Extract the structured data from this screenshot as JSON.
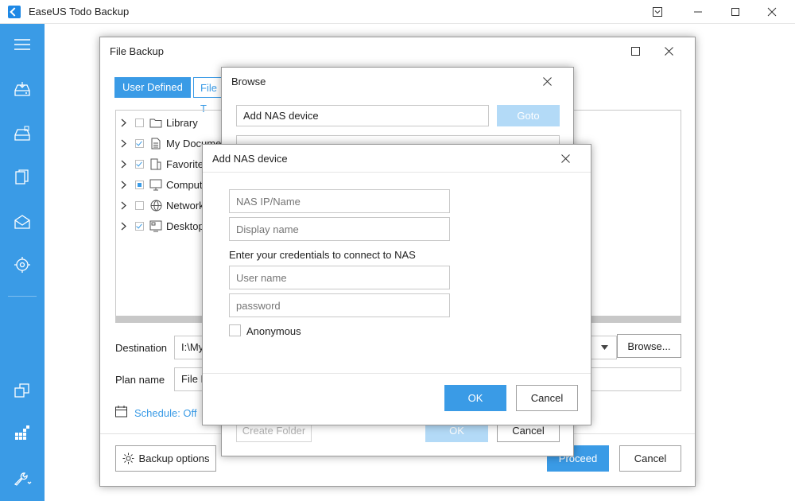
{
  "app": {
    "title": "EaseUS Todo Backup",
    "brand_color": "#3a9be6",
    "window_controls": [
      "dropdown-icon",
      "minimize-icon",
      "maximize-icon",
      "close-icon"
    ]
  },
  "sidebar": {
    "items": [
      {
        "icon": "menu-icon"
      },
      {
        "icon": "disk-backup-icon"
      },
      {
        "icon": "system-backup-icon"
      },
      {
        "icon": "file-backup-icon"
      },
      {
        "icon": "mail-backup-icon"
      },
      {
        "icon": "smart-backup-icon"
      },
      {
        "icon": "clone-icon"
      },
      {
        "icon": "tools-grid-icon"
      },
      {
        "icon": "wrench-icon"
      }
    ]
  },
  "file_backup": {
    "title": "File Backup",
    "tabs": [
      "User Defined",
      "File T"
    ],
    "tree": [
      {
        "label": "Library",
        "state": "unchecked",
        "icon": "folder-icon"
      },
      {
        "label": "My Documen",
        "state": "checked",
        "icon": "document-icon"
      },
      {
        "label": "Favorites",
        "state": "checked",
        "icon": "favorites-icon"
      },
      {
        "label": "Compute",
        "state": "partial",
        "icon": "computer-icon"
      },
      {
        "label": "Network",
        "state": "unchecked",
        "icon": "network-icon"
      },
      {
        "label": "Desktop",
        "state": "checked",
        "icon": "desktop-icon"
      }
    ],
    "destination_label": "Destination",
    "destination_value": "I:\\My",
    "browse_label": "Browse...",
    "plan_name_label": "Plan name",
    "plan_name_value": "File B",
    "schedule_label": "Schedule: Off",
    "backup_options_label": "Backup options",
    "proceed_label": "Proceed",
    "cancel_label": "Cancel"
  },
  "browse": {
    "title": "Browse",
    "path_value": "Add NAS device",
    "goto_label": "Goto",
    "create_folder_label": "Create Folder",
    "ok_label": "OK",
    "cancel_label": "Cancel"
  },
  "add_nas": {
    "title": "Add NAS device",
    "ip_placeholder": "NAS IP/Name",
    "display_placeholder": "Display name",
    "credentials_text": "Enter your credentials to connect to NAS",
    "user_placeholder": "User name",
    "password_placeholder": "password",
    "anonymous_label": "Anonymous",
    "ok_label": "OK",
    "cancel_label": "Cancel"
  }
}
